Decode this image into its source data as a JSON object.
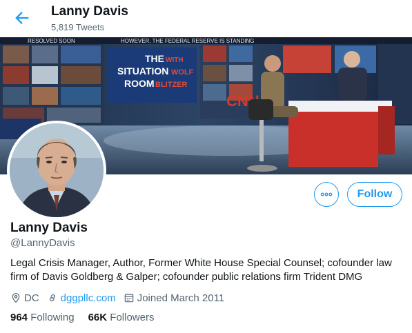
{
  "header": {
    "name": "Lanny Davis",
    "tweet_count": "5,819 Tweets"
  },
  "banner": {
    "ticker": "HOWEVER, THE FEDERAL RESERVE IS STANDING",
    "ticker_left": "RESOLVED SOON",
    "show_title_line1": "THE",
    "show_title_line2": "SITUATION",
    "show_title_line3": "ROOM",
    "show_title_with": "WITH",
    "show_title_wolf": "WOLF",
    "show_title_blitzer": "BLITZER",
    "network": "CNN"
  },
  "profile": {
    "name": "Lanny Davis",
    "handle": "@LannyDavis",
    "bio": "Legal Crisis Manager, Author, Former White House Special Counsel; cofounder law firm of Davis Goldberg & Galper; cofounder public relations firm Trident DMG",
    "location": "DC",
    "website": "dggpllc.com",
    "joined": "Joined March 2011",
    "following_count": "964",
    "following_label": "Following",
    "followers_count": "66K",
    "followers_label": "Followers",
    "follow_button": "Follow"
  },
  "colors": {
    "accent": "#1d9bf0",
    "secondary_text": "#536471"
  },
  "icons": [
    "back-arrow-icon",
    "more-icon",
    "location-icon",
    "link-icon",
    "calendar-icon"
  ]
}
